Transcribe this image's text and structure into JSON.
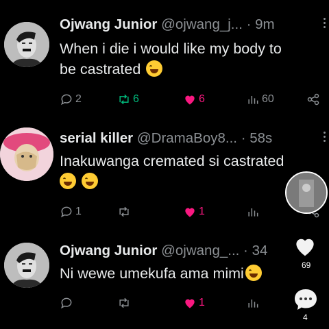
{
  "posts": [
    {
      "name": "Ojwang Junior",
      "handle": "@ojwang_j...",
      "time": "· 9m",
      "text_lines": [
        "When i  die i would like my body to",
        "be castrated"
      ],
      "replies": "2",
      "reposts": "6",
      "likes": "6",
      "views": "60",
      "liked": true
    },
    {
      "name": "serial killer",
      "handle": "@DramaBoy8...",
      "time": "· 58s",
      "text_lines": [
        "Inakuwanga cremated si castrated",
        ""
      ],
      "replies": "1",
      "reposts": "",
      "likes": "1",
      "views": "",
      "liked": true
    },
    {
      "name": "Ojwang Junior",
      "handle": "@ojwang_...",
      "time": "· 34",
      "text_lines": [
        "Ni wewe umekufa ama mimi"
      ],
      "replies": "",
      "reposts": "",
      "likes": "1",
      "views": "",
      "liked": true
    }
  ],
  "overlay": {
    "like_count": "69",
    "comment_count": "4"
  },
  "colors": {
    "background": "#000000",
    "text": "#e7e9ea",
    "muted": "#8b8f93",
    "like": "#f91880",
    "repost": "#00ba7c"
  }
}
